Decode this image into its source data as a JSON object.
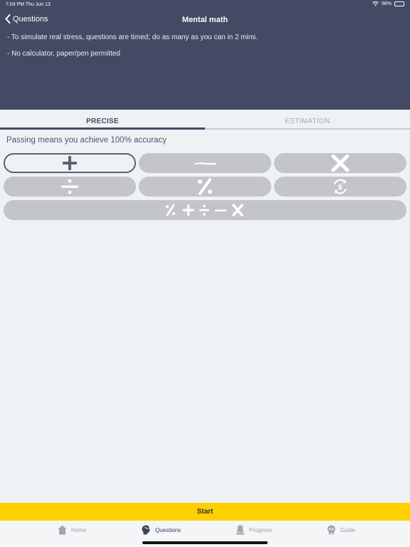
{
  "status": {
    "time": "7:04 PM  Thu Jun 13",
    "battery": "98%",
    "battery_level": 0.98
  },
  "nav": {
    "back_label": "Questions",
    "title": "Mental math"
  },
  "notes": [
    "- To simulate real stress, questions are timed; do as many as you can in 2 mins.",
    "- No calculator, paper/pen permitted"
  ],
  "tabs": [
    {
      "label": "PRECISE",
      "active": true
    },
    {
      "label": "ESTIMATION",
      "active": false
    }
  ],
  "passing_text": "Passing means you achieve 100% accuracy",
  "operations": [
    {
      "icon": "plus-icon",
      "selected": true
    },
    {
      "icon": "minus-icon",
      "selected": false
    },
    {
      "icon": "multiply-icon",
      "selected": false
    },
    {
      "icon": "divide-icon",
      "selected": false
    },
    {
      "icon": "percent-icon",
      "selected": false
    },
    {
      "icon": "currency-exchange-icon",
      "selected": false
    },
    {
      "icon": "all-operations-icon",
      "selected": false
    }
  ],
  "start_label": "Start",
  "tabbar": [
    {
      "label": "Home",
      "icon": "home-icon",
      "active": false
    },
    {
      "label": "Questions",
      "icon": "brain-icon",
      "active": true
    },
    {
      "label": "Progress",
      "icon": "progress-icon",
      "active": false
    },
    {
      "label": "Guide",
      "icon": "guide-icon",
      "active": false
    }
  ],
  "colors": {
    "header": "#454a64",
    "accent": "#ffd100",
    "button": "#c4c5c8"
  }
}
